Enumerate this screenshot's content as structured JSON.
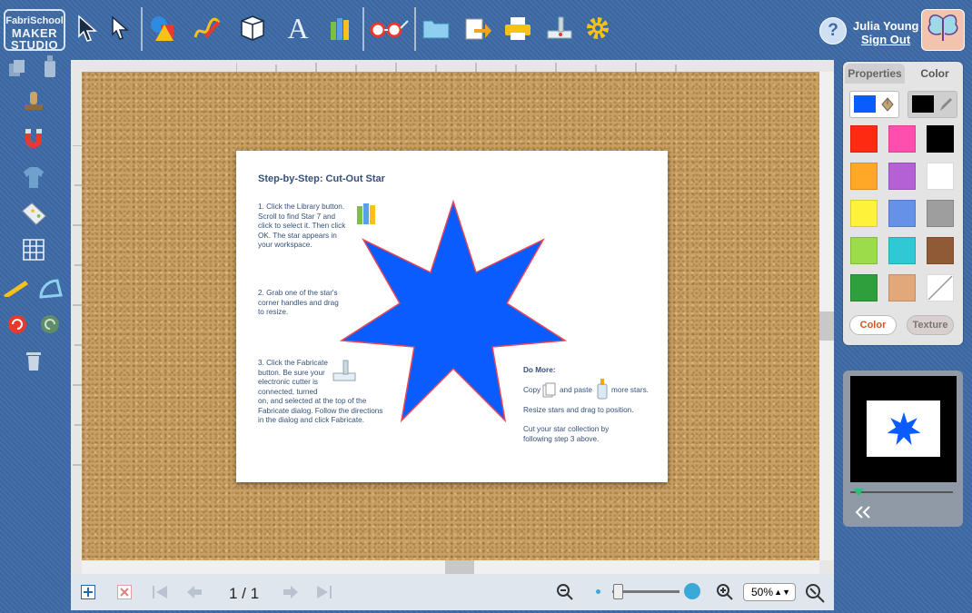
{
  "app": {
    "logo_line1": "FabriSchool",
    "logo_line2": "MAKER STUDIO"
  },
  "user": {
    "name": "Julia Young",
    "signout_label": "Sign Out",
    "help_label": "?"
  },
  "toolbar": {
    "icons": [
      "select-arrow-icon",
      "direct-select-arrow-icon",
      "shapes-icon",
      "draw-pencil-icon",
      "3d-box-icon",
      "text-icon",
      "library-books-icon",
      "view-glasses-icon",
      "open-folder-icon",
      "export-icon",
      "print-icon",
      "fabricate-cutter-icon",
      "settings-gear-icon"
    ]
  },
  "document": {
    "title": "Step-by-Step: Cut-Out Star",
    "step1": [
      "1. Click the Library button.",
      "Scroll to find Star 7 and",
      "click to select it. Then click",
      "OK.  The star appears in",
      "your workspace."
    ],
    "step2": [
      "2. Grab one of the star's",
      "corner handles and drag",
      "to resize."
    ],
    "step3": [
      "3. Click the Fabricate",
      "button. Be sure your",
      "electronic cutter is",
      "connected, turned",
      "on, and selected at the top of the",
      "Fabricate dialog. Follow the directions",
      "in the dialog and click Fabricate."
    ],
    "do_more_title": "Do More:",
    "do_more_copy_a": "Copy",
    "do_more_copy_b": "and paste",
    "do_more_copy_c": "more stars.",
    "do_more_resize": "Resize stars and drag to position.",
    "do_more_cut": [
      "Cut your star collection by",
      "following step 3 above."
    ],
    "star_color": "#0a5cff",
    "star_outline": "#e8475a"
  },
  "navigation": {
    "page_indicator": "1 / 1",
    "zoom_value": "50%"
  },
  "color_panel": {
    "tabs": [
      "Properties",
      "Color"
    ],
    "active_tab": "Color",
    "fill_color": "#0a5cff",
    "stroke_color": "#000000",
    "swatches": [
      "#ff2a12",
      "#ff4fae",
      "#000000",
      "#ffa726",
      "#b660d6",
      "#ffffff",
      "#fff23a",
      "#6591e8",
      "#9e9e9e",
      "#9cdc4b",
      "#2fc8d4",
      "#8f5a35",
      "#2f9e3d",
      "#e2a87a",
      "none"
    ],
    "mode_buttons": [
      "Color",
      "Texture"
    ],
    "active_mode": "Color"
  },
  "colors": {
    "background": "#3d6aa6",
    "cork": "#c99f63",
    "accent_text": "#34507a"
  }
}
